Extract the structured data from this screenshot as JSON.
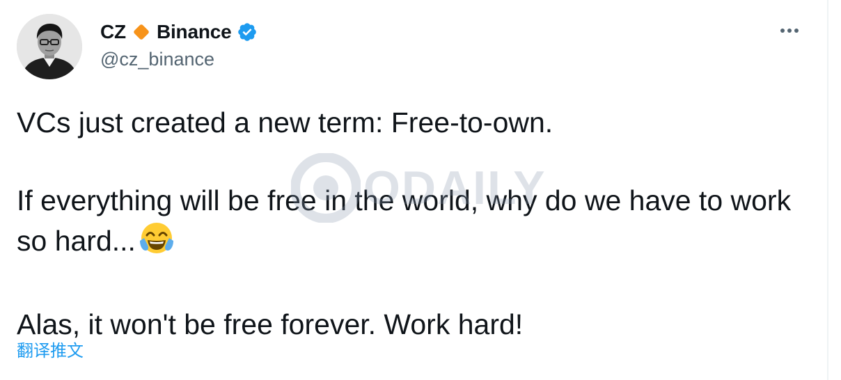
{
  "tweet": {
    "author": {
      "name": "CZ",
      "name_suffix": "Binance",
      "handle": "@cz_binance",
      "diamond_icon": "orange-diamond-icon",
      "verified_icon": "verified-badge-icon"
    },
    "more_icon": "more-options-icon",
    "paragraphs": [
      "VCs just created a new term: Free-to-own.",
      "If everything will be free in the world, why do we have to work so hard...",
      "Alas, it won't be free forever. Work hard!"
    ],
    "emoji_icon": "face-with-tears-of-joy-icon",
    "translate_label": "翻译推文"
  },
  "watermark": {
    "text": "ODAILY"
  },
  "colors": {
    "accent": "#1d9bf0",
    "diamond": "#f7931a",
    "secondary_text": "#536471",
    "primary_text": "#0f1419"
  }
}
